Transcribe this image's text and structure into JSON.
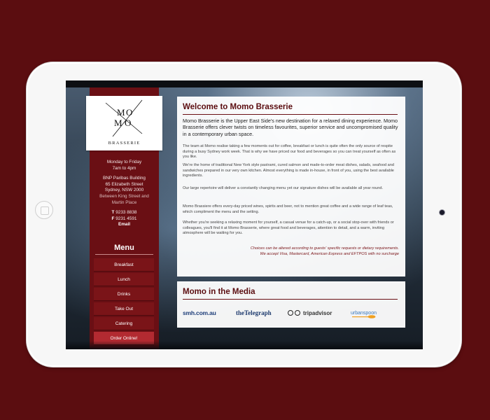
{
  "logo": {
    "letters": [
      "M",
      "O",
      "M",
      "O"
    ],
    "subtitle": "BRASSERIE"
  },
  "info": {
    "hours_days": "Monday to Friday",
    "hours_time": "7am to 4pm",
    "address_building": "BNP Paribas Building",
    "address_street": "65 Elizabeth Street",
    "address_city": "Sydney, NSW 2000",
    "address_between_1": "Between King Street and",
    "address_between_2": "Martin Place",
    "phone_label": "T",
    "phone": "9233 8838",
    "fax_label": "F",
    "fax": "9231 4591",
    "email_label": "Email"
  },
  "menu": {
    "title": "Menu",
    "items": [
      "Breakfast",
      "Lunch",
      "Drinks",
      "Take Out",
      "Catering",
      "Order Online!"
    ]
  },
  "welcome": {
    "title": "Welcome to Momo Brasserie",
    "lead": "Momo Brasserie is the Upper East Side's new destination for a relaxed dining experience. Momo Brasserie offers clever twists on timeless favourites, superior service and uncompromised quality in a contemporary urban space.",
    "p1": "The team at Momo realise taking a few moments out for coffee, breakfast or lunch is quite often the only source of respite during a busy Sydney work week. That is why we have priced our food and beverages so you can treat yourself as often as you like.",
    "p2": "We're the home of traditional New York style pastrami, cured salmon and made-to-order meat dishes, salads, seafood and sandwiches prepared in our very own kitchen. Almost everything is made in-house, in front of you, using the best available ingredients.",
    "p3": "Our large repertoire will deliver a constantly changing menu yet our signature dishes will be available all year round.",
    "p4": "Momo Brassiere offers every-day priced wines, spirits and beer, not to mention great coffee and a wide range of leaf teas, which compliment the menu and the setting.",
    "p5": "Whether you're seeking a relaxing moment for yourself, a casual venue for a catch-up, or a social stop-over with friends or colleagues, you'll find it at Momo Brasserie, where great food and beverages, attention to detail, and a warm, inviting atmosphere will be waiting for you.",
    "note1": "Choices can be altered according to guests' specific requests or dietary requirements.",
    "note2": "We accept Visa, Mastercard, American Express and EFTPOS with no surcharge"
  },
  "media": {
    "title": "Momo in the Media",
    "logos": [
      "smh.com.au",
      "theTelegraph",
      "tripadvisor",
      "urbanspoon"
    ]
  },
  "colors": {
    "brand": "#6a0f14",
    "background": "#5b0d10",
    "order_button": "#b32a31"
  }
}
